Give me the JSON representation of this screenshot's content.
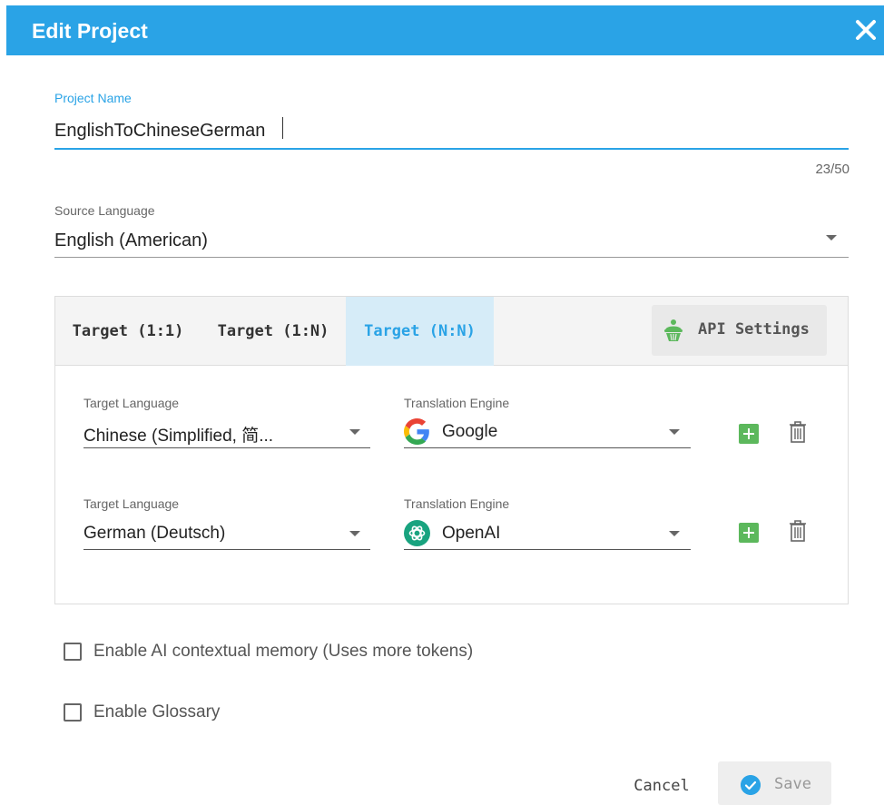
{
  "dialog": {
    "title": "Edit Project"
  },
  "project_name": {
    "label": "Project Name",
    "value": "EnglishToChineseGerman",
    "counter": "23/50"
  },
  "source_language": {
    "label": "Source Language",
    "value": "English (American)"
  },
  "tabs": [
    {
      "label": "Target (1:1)",
      "active": false
    },
    {
      "label": "Target (1:N)",
      "active": false
    },
    {
      "label": "Target (N:N)",
      "active": true
    }
  ],
  "api_settings": {
    "label": "API Settings",
    "icon": "cupcake-icon"
  },
  "rows": [
    {
      "target_label": "Target Language",
      "target_value": "Chinese (Simplified, 简...",
      "engine_label": "Translation Engine",
      "engine_value": "Google",
      "engine_icon": "google-icon"
    },
    {
      "target_label": "Target Language",
      "target_value": "German (Deutsch)",
      "engine_label": "Translation Engine",
      "engine_value": "OpenAI",
      "engine_icon": "openai-icon"
    }
  ],
  "options": [
    {
      "label": "Enable AI contextual memory (Uses more tokens)",
      "checked": false
    },
    {
      "label": "Enable Glossary",
      "checked": false
    }
  ],
  "footer": {
    "cancel_label": "Cancel",
    "save_label": "Save"
  },
  "colors": {
    "accent": "#2aa3e6",
    "add_green": "#5cb85c",
    "active_tab_bg": "#d6ecf8"
  }
}
